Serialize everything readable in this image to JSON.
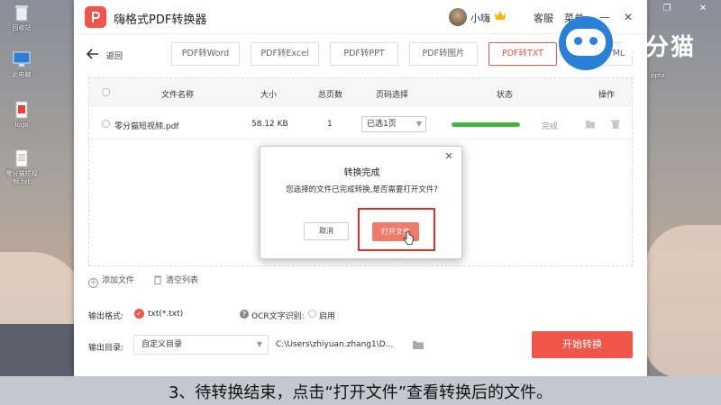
{
  "desktop": {
    "icons": [
      {
        "label": "回收站",
        "icon": "recycle-bin-icon"
      },
      {
        "label": "此电脑",
        "icon": "computer-icon"
      },
      {
        "label": "logo",
        "icon": "image-file-icon"
      },
      {
        "label": "零分猫短视频.txt",
        "icon": "text-file-icon"
      }
    ],
    "right_icon_label": "pptx"
  },
  "watermark": {
    "text": "零分猫"
  },
  "app": {
    "title": "嗨格式PDF转换器",
    "username": "小嗨",
    "service": "客服",
    "menu": "菜单",
    "back": "返回",
    "tabs": [
      "PDF转Word",
      "PDF转Excel",
      "PDF转PPT",
      "PDF转图片",
      "PDF转TXT",
      "PDF转HTML"
    ],
    "active_tab": "PDF转TXT",
    "table": {
      "headers": [
        "文件名称",
        "大小",
        "总页数",
        "页码选择",
        "状态",
        "操作"
      ],
      "rows": [
        {
          "name": "零分猫短视频.pdf",
          "size": "58.12 KB",
          "pages": "1",
          "page_select": "已选1页",
          "progress": 1.0,
          "status": "完成"
        }
      ]
    },
    "add_file": "添加文件",
    "clear_list": "清空列表",
    "output_format_label": "输出格式:",
    "output_format_value": "txt(*.txt)",
    "ocr_label": "OCR文字识别:",
    "ocr_enable": "启用",
    "output_dir_label": "输出目录:",
    "output_dir_select": "自定义目录",
    "output_path": "C:\\Users\\zhiyuan.zhang1\\D...",
    "start_button": "开始转换"
  },
  "dialog": {
    "title": "转换完成",
    "message": "您选择的文件已完成转换,是否需要打开文件?",
    "cancel": "取消",
    "open": "打开文件"
  },
  "caption": "3、待转换结束，点击“打开文件”查看转换后的文件。",
  "colors": {
    "accent": "#f0554a",
    "progress": "#46b43f",
    "highlight": "#e0302a"
  }
}
